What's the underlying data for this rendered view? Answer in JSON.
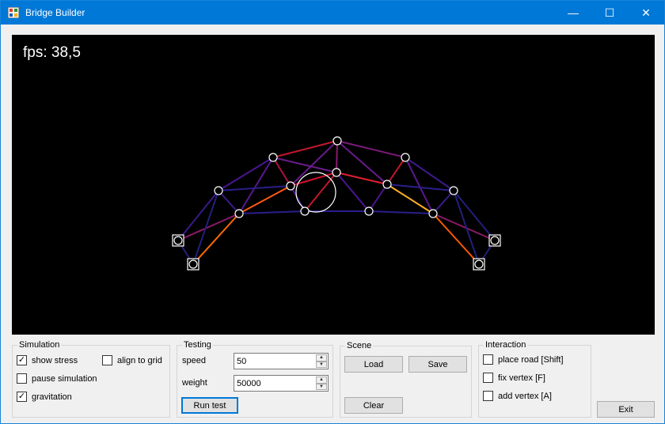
{
  "window": {
    "title": "Bridge Builder",
    "minimize": "—",
    "maximize": "☐",
    "close": "✕"
  },
  "canvas": {
    "fps_text": "fps: 38,5"
  },
  "simulation": {
    "legend": "Simulation",
    "show_stress": {
      "label": "show stress",
      "checked": true
    },
    "align_to_grid": {
      "label": "align to grid",
      "checked": false
    },
    "pause_simulation": {
      "label": "pause simulation",
      "checked": false
    },
    "gravitation": {
      "label": "gravitation",
      "checked": true
    }
  },
  "testing": {
    "legend": "Testing",
    "speed_label": "speed",
    "speed_value": "50",
    "weight_label": "weight",
    "weight_value": "50000",
    "run_test": "Run test"
  },
  "scene": {
    "legend": "Scene",
    "load": "Load",
    "save": "Save",
    "clear": "Clear"
  },
  "interaction": {
    "legend": "Interaction",
    "place_road": {
      "label": "place road [Shift]",
      "checked": false
    },
    "fix_vertex": {
      "label": "fix vertex [F]",
      "checked": false
    },
    "add_vertex": {
      "label": "add vertex [A]",
      "checked": false
    }
  },
  "exit": "Exit"
}
